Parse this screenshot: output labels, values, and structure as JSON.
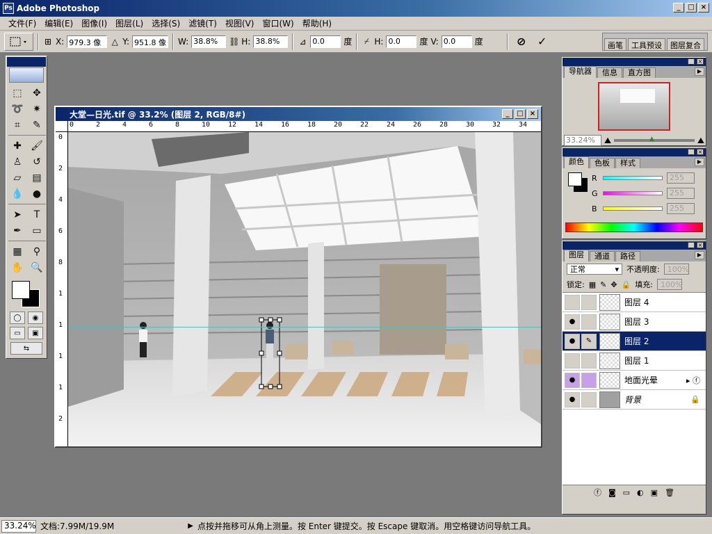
{
  "app": {
    "title": "Adobe Photoshop"
  },
  "menu": [
    "文件(F)",
    "编辑(E)",
    "图像(I)",
    "图层(L)",
    "选择(S)",
    "滤镜(T)",
    "视图(V)",
    "窗口(W)",
    "帮助(H)"
  ],
  "options": {
    "x_label": "X:",
    "x_value": "979.3 像",
    "y_label": "Y:",
    "y_value": "951.8 像",
    "w_label": "W:",
    "w_value": "38.8%",
    "h_label": "H:",
    "h_value": "38.8%",
    "angle_value": "0.0",
    "angle_unit": "度",
    "skew_h_label": "H:",
    "skew_h_value": "0.0",
    "skew_h_unit": "度",
    "skew_v_label": "V:",
    "skew_v_value": "0.0",
    "well_tabs": [
      "画笔",
      "工具预设",
      "图层复合"
    ]
  },
  "document": {
    "title": "大堂—日光.tif @ 33.2% (图层 2, RGB/8#)",
    "ruler_top": [
      "0",
      "2",
      "4",
      "6",
      "8",
      "10",
      "12",
      "14",
      "16",
      "18",
      "20",
      "22",
      "24",
      "26",
      "28",
      "30",
      "32",
      "34"
    ],
    "ruler_left": [
      "0",
      "2",
      "4",
      "6",
      "8",
      "1",
      "1",
      "1",
      "1",
      "2"
    ]
  },
  "navigator": {
    "tabs": [
      "导航器",
      "信息",
      "直方图"
    ],
    "zoom": "33.24%"
  },
  "color": {
    "tabs": [
      "颜色",
      "色板",
      "样式"
    ],
    "r_label": "R",
    "r_value": "255",
    "g_label": "G",
    "g_value": "255",
    "b_label": "B",
    "b_value": "255"
  },
  "layers": {
    "tabs": [
      "图层",
      "通道",
      "路径"
    ],
    "blend_mode": "正常",
    "opacity_label": "不透明度:",
    "opacity_value": "100%",
    "lock_label": "锁定:",
    "fill_label": "填充:",
    "fill_value": "100%",
    "items": [
      {
        "name": "图层 4"
      },
      {
        "name": "图层 3"
      },
      {
        "name": "图层 2"
      },
      {
        "name": "图层 1"
      },
      {
        "name": "地面光晕"
      },
      {
        "name": "背景"
      }
    ]
  },
  "status": {
    "zoom": "33.24%",
    "doc_info": "文档:7.99M/19.9M",
    "hint": "点按并拖移可从角上测量。按 Enter 键提交。按 Escape 键取消。用空格键访问导航工具。"
  },
  "colors": {
    "title_blue": "#0a246a",
    "selection": "#0a246a",
    "guide": "#00e0e0",
    "chrome": "#d4d0c8"
  }
}
